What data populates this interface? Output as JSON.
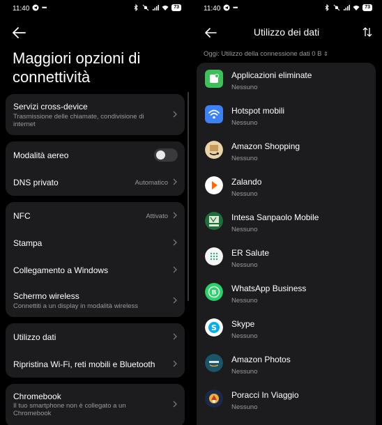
{
  "status_bar": {
    "time": "11:40",
    "battery": "73"
  },
  "left": {
    "title": "Maggiori opzioni di connettività",
    "groups": [
      {
        "items": [
          {
            "label": "Servizi cross-device",
            "sub": "Trasmissione delle chiamate, condivisione di internet"
          }
        ]
      },
      {
        "items": [
          {
            "label": "Modalità aereo",
            "toggle": false
          },
          {
            "label": "DNS privato",
            "value": "Automatico"
          }
        ]
      },
      {
        "items": [
          {
            "label": "NFC",
            "value": "Attivato"
          },
          {
            "label": "Stampa"
          },
          {
            "label": "Collegamento a Windows"
          },
          {
            "label": "Schermo wireless",
            "sub": "Connettiti a un display in modalità wireless"
          }
        ]
      },
      {
        "items": [
          {
            "label": "Utilizzo dati"
          },
          {
            "label": "Ripristina Wi-Fi, reti mobili e Bluetooth"
          }
        ]
      },
      {
        "items": [
          {
            "label": "Chromebook",
            "sub": "Il tuo smartphone non è collegato a un Chromebook"
          }
        ]
      }
    ]
  },
  "right": {
    "title": "Utilizzo dei dati",
    "subtitle": "Oggi: Utilizzo della connessione dati 0 B",
    "apps": [
      {
        "name": "Applicazioni eliminate",
        "usage": "Nessuno",
        "icon": "deleted-apps-icon",
        "color": "#3dbf5a"
      },
      {
        "name": "Hotspot mobili",
        "usage": "Nessuno",
        "icon": "hotspot-icon",
        "color": "#3b82f6"
      },
      {
        "name": "Amazon Shopping",
        "usage": "Nessuno",
        "icon": "amazon-shopping-icon",
        "color": "#e9d3a8"
      },
      {
        "name": "Zalando",
        "usage": "Nessuno",
        "icon": "zalando-icon",
        "color": "#ff6900"
      },
      {
        "name": "Intesa Sanpaolo Mobile",
        "usage": "Nessuno",
        "icon": "intesa-sanpaolo-icon",
        "color": "#1f6f3c"
      },
      {
        "name": "ER Salute",
        "usage": "Nessuno",
        "icon": "er-salute-icon",
        "color": "#f5f5f5"
      },
      {
        "name": "WhatsApp Business",
        "usage": "Nessuno",
        "icon": "whatsapp-business-icon",
        "color": "#25d366"
      },
      {
        "name": "Skype",
        "usage": "Nessuno",
        "icon": "skype-icon",
        "color": "#ffffff"
      },
      {
        "name": "Amazon Photos",
        "usage": "Nessuno",
        "icon": "amazon-photos-icon",
        "color": "#1a5568"
      },
      {
        "name": "Poracci In Viaggio",
        "usage": "Nessuno",
        "icon": "poracci-in-viaggio-icon",
        "color": "#1a2a4a"
      }
    ]
  }
}
